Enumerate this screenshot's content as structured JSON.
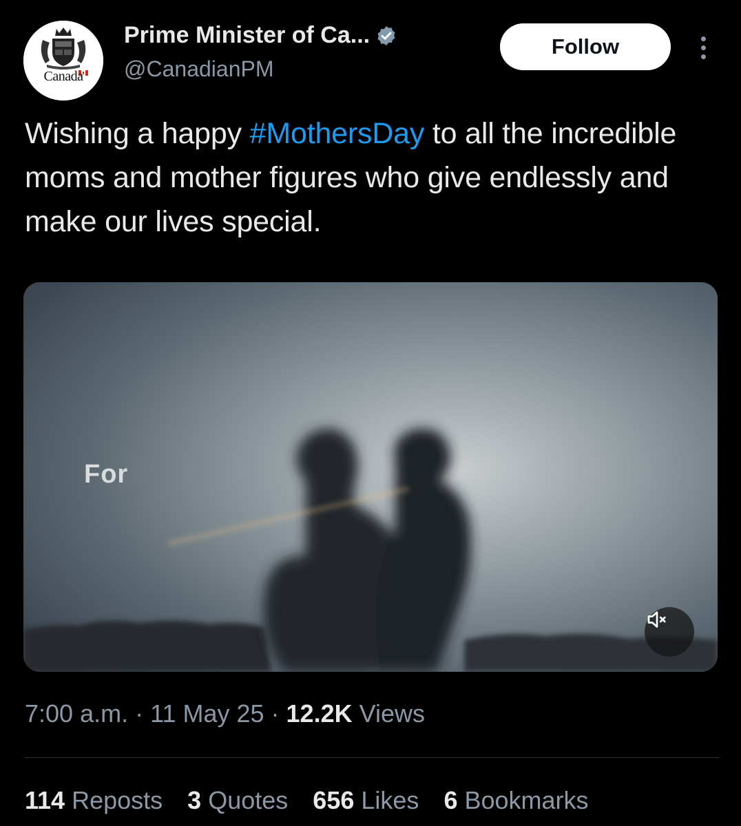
{
  "account": {
    "display_name": "Prime Minister of Ca...",
    "handle": "@CanadianPM",
    "avatar_wordmark": "Canada",
    "verified": true
  },
  "actions": {
    "follow_label": "Follow",
    "more_icon": "ellipsis-vertical-icon"
  },
  "tweet": {
    "text_before": "Wishing a happy ",
    "hashtag": "#MothersDay",
    "text_after": " to all the incredible moms and mother figures who give endlessly and make our lives special."
  },
  "media": {
    "caption": "For",
    "mute_icon": "volume-muted-icon"
  },
  "meta": {
    "time": "7:00 a.m.",
    "date": "11 May 25",
    "views_count": "12.2K",
    "views_label": "Views"
  },
  "stats": [
    {
      "count": "114",
      "label": "Reposts"
    },
    {
      "count": "3",
      "label": "Quotes"
    },
    {
      "count": "656",
      "label": "Likes"
    },
    {
      "count": "6",
      "label": "Bookmarks"
    }
  ],
  "colors": {
    "background": "#000000",
    "hashtag": "#1d9bf0",
    "verified_badge": "#829aab",
    "secondary_text": "#8b98a5"
  }
}
